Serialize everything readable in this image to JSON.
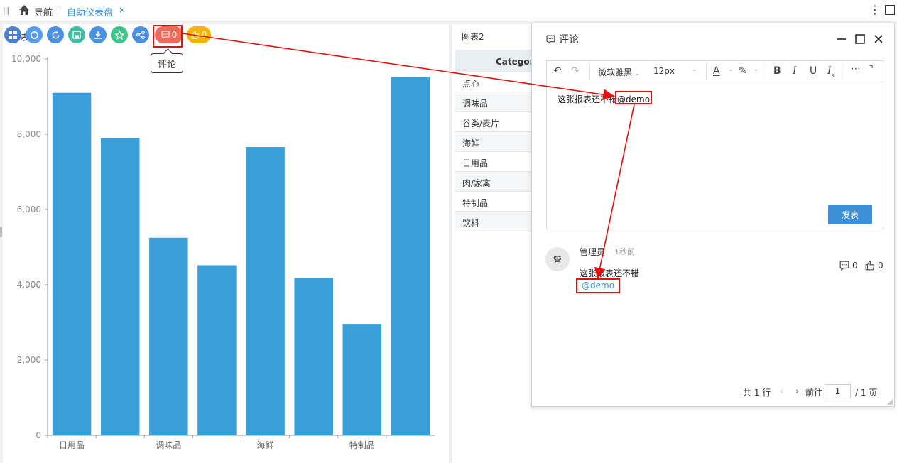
{
  "topbar": {
    "nav_label": "导航",
    "active_tab": "自助仪表盘",
    "close_glyph": "×",
    "more_glyph": "⋮"
  },
  "toolbar": {
    "buttons": [
      {
        "icon": "layout-icon",
        "color": "#4a7fd4"
      },
      {
        "icon": "sync-icon",
        "color": "#5a9cf0"
      },
      {
        "icon": "refresh-icon",
        "color": "#4a90e2"
      },
      {
        "icon": "save-icon",
        "color": "#3fbfa0"
      },
      {
        "icon": "download-icon",
        "color": "#4a90e2"
      },
      {
        "icon": "star-icon",
        "color": "#3fc48a"
      },
      {
        "icon": "share-icon",
        "color": "#4a90e2"
      }
    ],
    "comment_count": "0",
    "comment_color": "#ee6a5a",
    "like_count": "0",
    "like_color": "#f5b400",
    "title_fragment": "表",
    "tooltip": "评论"
  },
  "chart_data": {
    "type": "bar",
    "categories": [
      "日用品",
      "",
      "调味品",
      "",
      "海鲜",
      "",
      "特制品",
      ""
    ],
    "values": [
      9100,
      7900,
      5250,
      4520,
      7660,
      4180,
      2960,
      9520
    ],
    "yticks": [
      "0",
      "2,000",
      "4,000",
      "6,000",
      "8,000",
      "10,000"
    ],
    "ylim": [
      0,
      10000
    ],
    "color": "#3a9fd8",
    "grid": false
  },
  "table": {
    "title": "图表2",
    "header": "Category",
    "rows": [
      "点心",
      "调味品",
      "谷类/麦片",
      "海鲜",
      "日用品",
      "肉/家禽",
      "特制品",
      "饮料"
    ]
  },
  "dialog": {
    "title": "评论",
    "editor": {
      "font": "微软雅黑",
      "size": "12px",
      "text": "这张报表还不错",
      "mention": "@demo",
      "send_label": "发表"
    },
    "comment": {
      "avatar": "管",
      "author": "管理员",
      "time": "1秒前",
      "text": "这张报表还不错",
      "mention": "@demo",
      "reply_count": "0",
      "like_count": "0"
    },
    "pager": {
      "total": "共 1 行",
      "goto": "前往",
      "page": "1",
      "pages": "/ 1 页"
    }
  }
}
